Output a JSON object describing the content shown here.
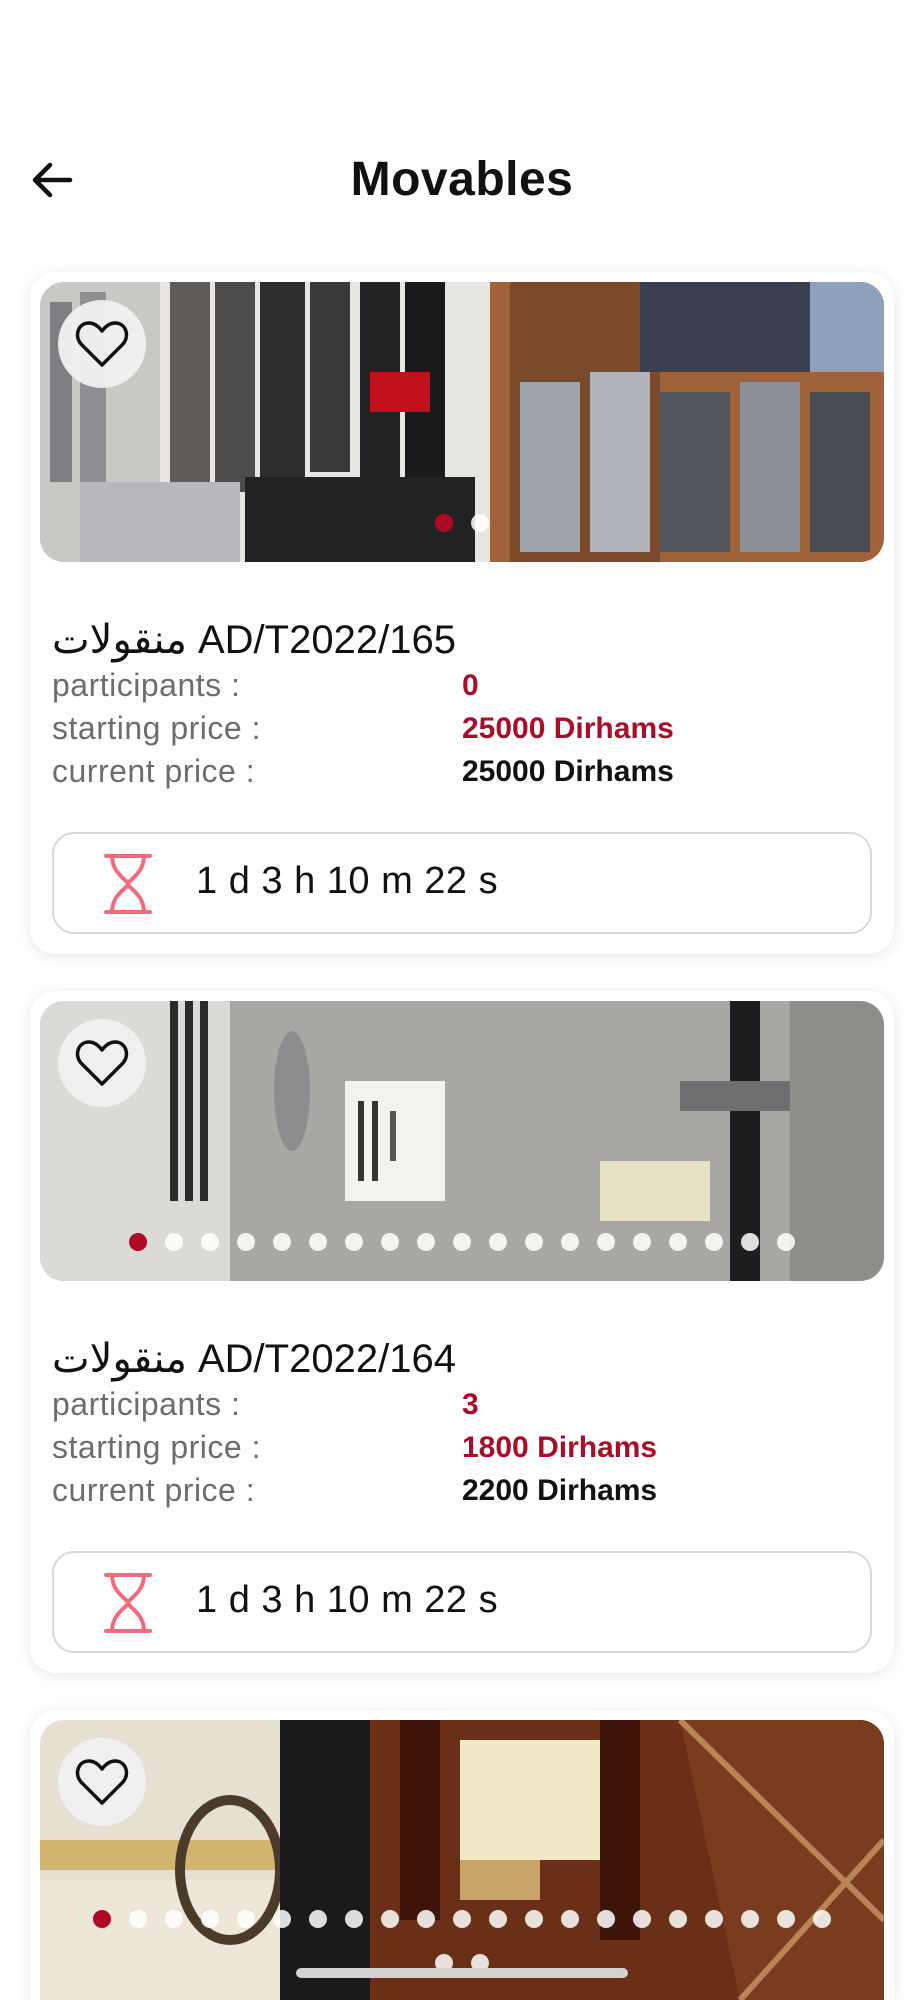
{
  "header": {
    "title": "Movables"
  },
  "icons": {
    "back": "arrow-left-icon",
    "favorite": "heart-outline-icon",
    "timer": "hourglass-icon"
  },
  "colors": {
    "accent_red": "#a80e28",
    "timer_icon": "#f06b7d",
    "active_dot": "#b00a25"
  },
  "labels": {
    "participants": "participants :",
    "starting_price": "starting price :",
    "current_price": "current price :"
  },
  "lots": [
    {
      "title": "منقولات AD/T2022/165",
      "participants": "0",
      "starting_price": "25000 Dirhams",
      "current_price": "25000 Dirhams",
      "time_left": "1 d 3 h 10 m 22 s",
      "photo_count": 2,
      "active_photo": 1
    },
    {
      "title": "منقولات AD/T2022/164",
      "participants": "3",
      "starting_price": "1800 Dirhams",
      "current_price": "2200 Dirhams",
      "time_left": "1 d 3 h 10 m 22 s",
      "photo_count": 19,
      "active_photo": 1
    },
    {
      "photo_count": 23,
      "active_photo": 1
    }
  ]
}
